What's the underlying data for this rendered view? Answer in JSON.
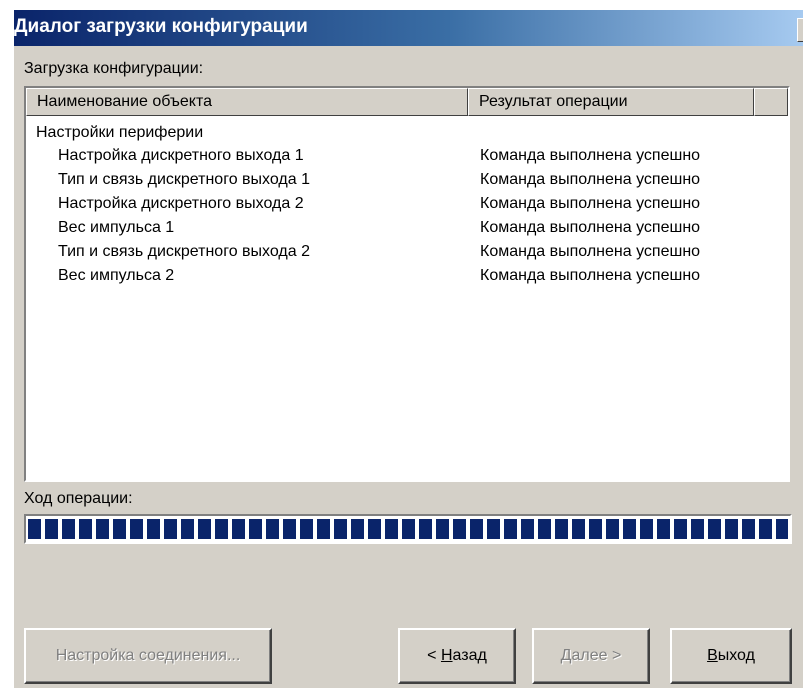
{
  "window": {
    "title": "Диалог загрузки конфигурации",
    "close_glyph": "×"
  },
  "section_label": "Загрузка конфигурации:",
  "list": {
    "columns": [
      "Наименование объекта",
      "Результат операции",
      ""
    ],
    "group": "Настройки периферии",
    "rows": [
      {
        "name": "Настройка дискретного выхода 1",
        "result": "Команда выполнена успешно"
      },
      {
        "name": "Тип и связь дискретного выхода 1",
        "result": "Команда выполнена успешно"
      },
      {
        "name": "Настройка дискретного выхода 2",
        "result": "Команда выполнена успешно"
      },
      {
        "name": "Вес импульса 1",
        "result": "Команда выполнена успешно"
      },
      {
        "name": "Тип и связь дискретного выхода 2",
        "result": "Команда выполнена успешно"
      },
      {
        "name": "Вес импульса 2",
        "result": "Команда выполнена успешно"
      }
    ]
  },
  "progress": {
    "label": "Ход операции:",
    "value_percent": 100
  },
  "buttons": {
    "connection_settings": "Настройка соединения...",
    "back_prefix": "< ",
    "back_hotkey": "Н",
    "back_rest": "азад",
    "next_hotkey": "Д",
    "next_rest": "алее >",
    "exit_hotkey": "В",
    "exit_rest": "ыход"
  },
  "colors": {
    "title_gradient_start": "#0a246a",
    "progress_fill": "#0a246a",
    "face": "#d4d0c8"
  }
}
